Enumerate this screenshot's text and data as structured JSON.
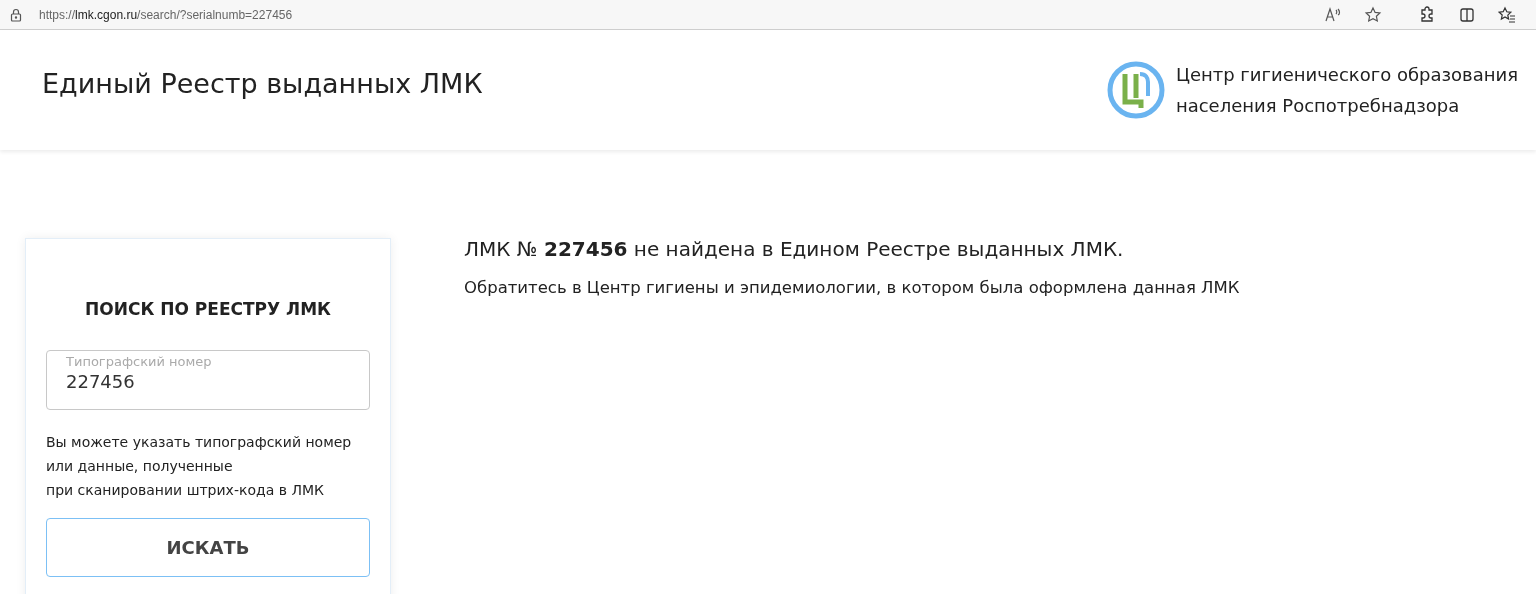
{
  "browser": {
    "url": "https://**lmk.cgon.ru**/search/?serialnumb=227456"
  },
  "header": {
    "title": "Единый Реестр выданных ЛМК",
    "org_lines": [
      "Центр гигиенического образования",
      "населения Роспотребнадзора"
    ]
  },
  "search_card": {
    "title": "ПОИСК ПО РЕЕСТРУ ЛМК",
    "field": {
      "label": "Типографский номер",
      "value": "227456"
    },
    "hint_lines": [
      "Вы можете указать типографский номер",
      "или данные, полученные",
      "при сканировании штрих-кода в ЛМК"
    ],
    "button": "ИСКАТЬ"
  },
  "result": {
    "message": "ЛМК № **227456** не найдена в Едином Реестре выданных ЛМК.",
    "advice": "Обратитесь в Центр гигиены и эпидемиологии, в котором была оформлена данная ЛМК"
  }
}
